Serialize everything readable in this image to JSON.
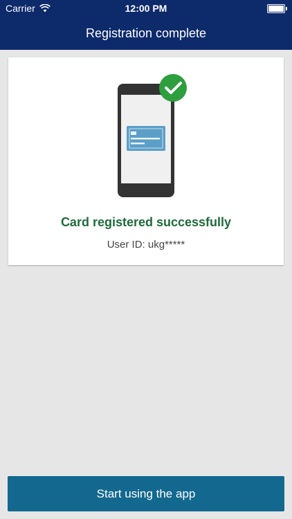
{
  "status_bar": {
    "carrier": "Carrier",
    "time": "12:00 PM",
    "wifi_icon": "wifi-icon",
    "battery_icon": "battery-icon"
  },
  "header": {
    "title": "Registration complete",
    "background": "#0d2a6b"
  },
  "success_card": {
    "illustration_icon": "phone-with-card-checkmark-icon",
    "message": "Card registered successfully",
    "message_color": "#1e6b3b",
    "user_id": "User ID: ukg*****"
  },
  "actions": {
    "start_label": "Start using the app",
    "button_color": "#13688f"
  }
}
